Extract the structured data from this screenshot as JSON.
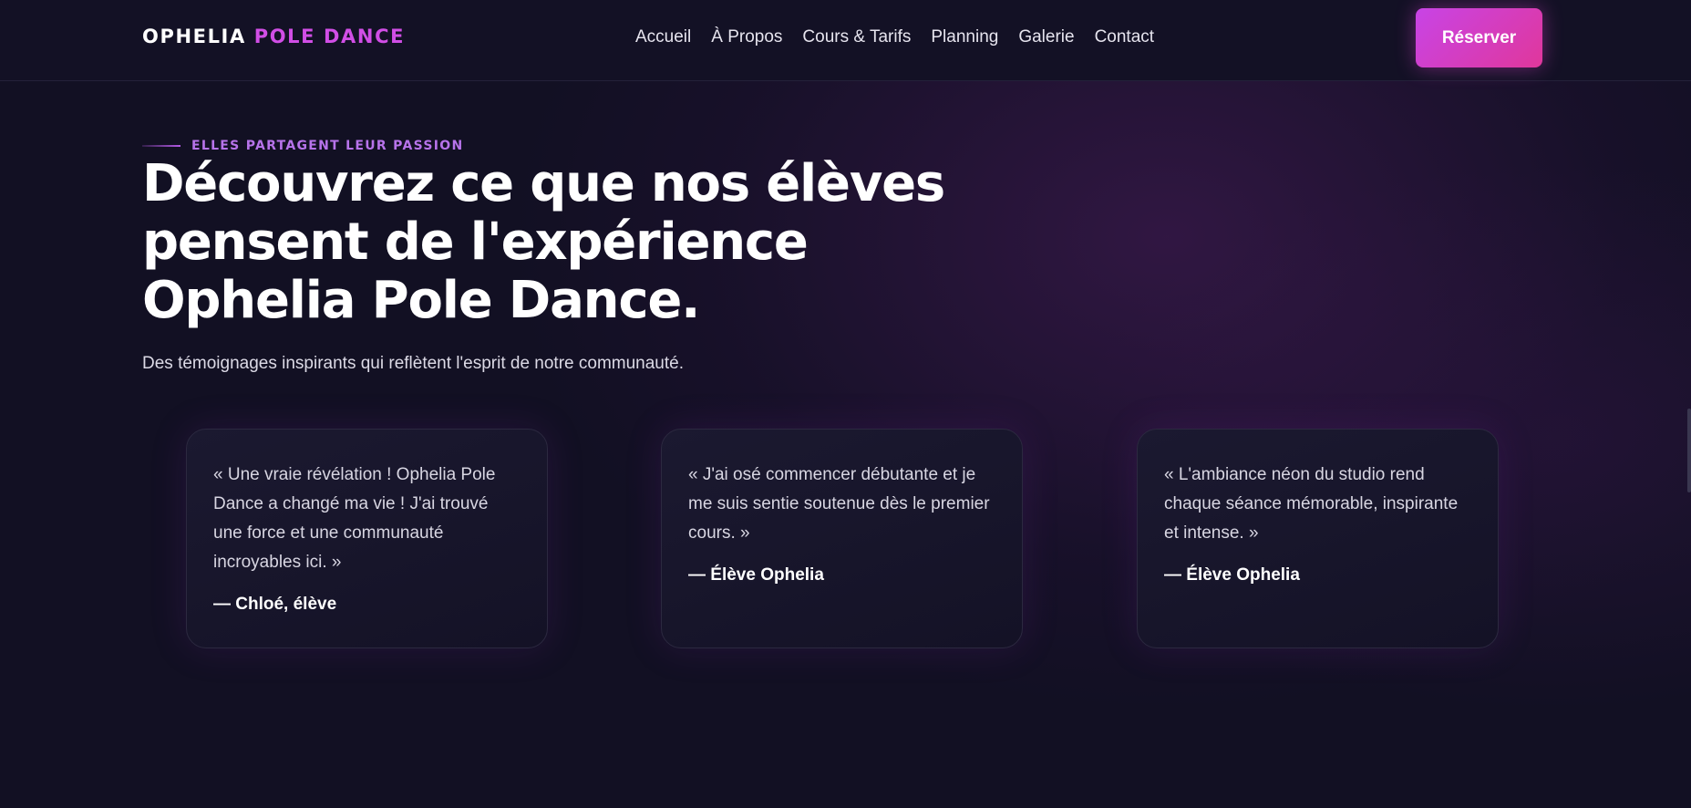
{
  "header": {
    "logo_part1": "OPHELIA",
    "logo_part2": "POLE DANCE",
    "nav": [
      "Accueil",
      "À Propos",
      "Cours & Tarifs",
      "Planning",
      "Galerie",
      "Contact"
    ],
    "cta_label": "Réserver"
  },
  "hero": {
    "eyebrow": "ELLES PARTAGENT LEUR PASSION",
    "title": "Découvrez ce que nos élèves pensent de l'expérience Ophelia Pole Dance.",
    "subtitle": "Des témoignages inspirants qui reflètent l'esprit de notre communauté."
  },
  "testimonials": [
    {
      "quote": "« Une vraie révélation ! Ophelia Pole Dance a changé ma vie ! J'ai trouvé une force et une communauté incroyables ici. »",
      "author": "— Chloé, élève"
    },
    {
      "quote": "« J'ai osé commencer débutante et je me suis sentie soutenue dès le premier cours. »",
      "author": "— Élève Ophelia"
    },
    {
      "quote": "« L'ambiance néon du studio rend chaque séance mémorable, inspirante et intense. »",
      "author": "— Élève Ophelia"
    }
  ],
  "colors": {
    "background": "#121023",
    "accent": "#d14ee6",
    "accent_gradient_end": "#e0379b",
    "eyebrow": "#b773ea"
  }
}
